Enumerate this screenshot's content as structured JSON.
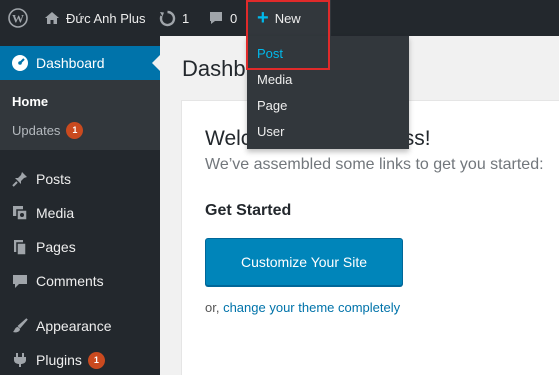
{
  "adminbar": {
    "site_name": "Đức Anh Plus",
    "updates_count": "1",
    "comments_count": "0",
    "new_label": "New"
  },
  "new_menu": {
    "items": [
      "Post",
      "Media",
      "Page",
      "User"
    ]
  },
  "sidebar": {
    "dashboard_label": "Dashboard",
    "submenu": {
      "home": "Home",
      "updates": "Updates",
      "updates_badge": "1"
    },
    "items": [
      {
        "label": "Posts",
        "icon": "pin-icon"
      },
      {
        "label": "Media",
        "icon": "media-icon"
      },
      {
        "label": "Pages",
        "icon": "pages-icon"
      },
      {
        "label": "Comments",
        "icon": "comment-icon"
      },
      {
        "label": "Appearance",
        "icon": "brush-icon"
      },
      {
        "label": "Plugins",
        "icon": "plugin-icon",
        "badge": "1"
      }
    ]
  },
  "main": {
    "page_title": "Dashb",
    "welcome_heading": "Welcome to WordPress!",
    "welcome_sub": "We’ve assembled some links to get you started:",
    "get_started": "Get Started",
    "customize_button": "Customize Your Site",
    "theme_prefix": "or, ",
    "theme_link": "change your theme completely"
  },
  "colors": {
    "adminbar_bg": "#23282d",
    "accent": "#0073aa",
    "button": "#0085ba",
    "highlight_border": "#e02a2a",
    "badge": "#ca4a1f"
  }
}
